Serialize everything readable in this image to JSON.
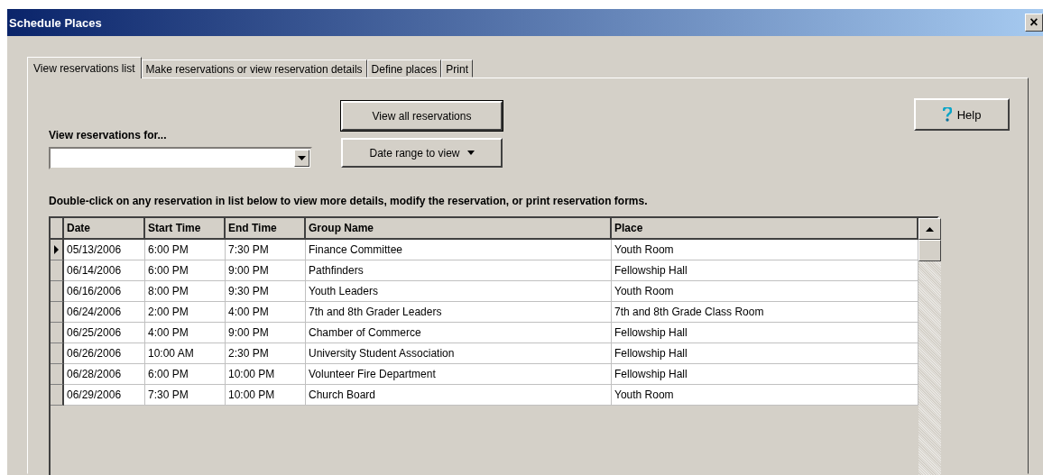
{
  "window": {
    "title": "Schedule Places",
    "close": "×"
  },
  "tabs": [
    {
      "label": "View reservations list",
      "selected": true
    },
    {
      "label": "Make reservations or view reservation details",
      "selected": false
    },
    {
      "label": "Define places",
      "selected": false
    },
    {
      "label": "Print",
      "selected": false
    }
  ],
  "filter": {
    "label": "View reservations for..."
  },
  "buttons": {
    "view_all": "View all reservations",
    "date_range": "Date range to view",
    "help": "Help"
  },
  "instruction": "Double-click on any reservation in list below to view more details, modify the reservation, or print reservation forms.",
  "table": {
    "columns": [
      "Date",
      "Start Time",
      "End Time",
      "Group Name",
      "Place"
    ],
    "rows": [
      {
        "cells": [
          "05/13/2006",
          "6:00 PM",
          "7:30 PM",
          "Finance Committee",
          "Youth Room"
        ],
        "selected": true
      },
      {
        "cells": [
          "06/14/2006",
          "6:00 PM",
          "9:00 PM",
          "Pathfinders",
          "Fellowship Hall"
        ],
        "selected": false
      },
      {
        "cells": [
          "06/16/2006",
          "8:00 PM",
          "9:30 PM",
          "Youth Leaders",
          "Youth Room"
        ],
        "selected": false
      },
      {
        "cells": [
          "06/24/2006",
          "2:00 PM",
          "4:00 PM",
          "7th and 8th Grader Leaders",
          "7th and 8th Grade Class Room"
        ],
        "selected": false
      },
      {
        "cells": [
          "06/25/2006",
          "4:00 PM",
          "9:00 PM",
          "Chamber of Commerce",
          "Fellowship Hall"
        ],
        "selected": false
      },
      {
        "cells": [
          "06/26/2006",
          "10:00 AM",
          "2:30 PM",
          "University Student Association",
          "Fellowship Hall"
        ],
        "selected": false
      },
      {
        "cells": [
          "06/28/2006",
          "6:00 PM",
          "10:00 PM",
          "Volunteer Fire Department",
          "Fellowship Hall"
        ],
        "selected": false
      },
      {
        "cells": [
          "06/29/2006",
          "7:30 PM",
          "10:00 PM",
          "Church Board",
          "Youth Room"
        ],
        "selected": false
      }
    ]
  }
}
